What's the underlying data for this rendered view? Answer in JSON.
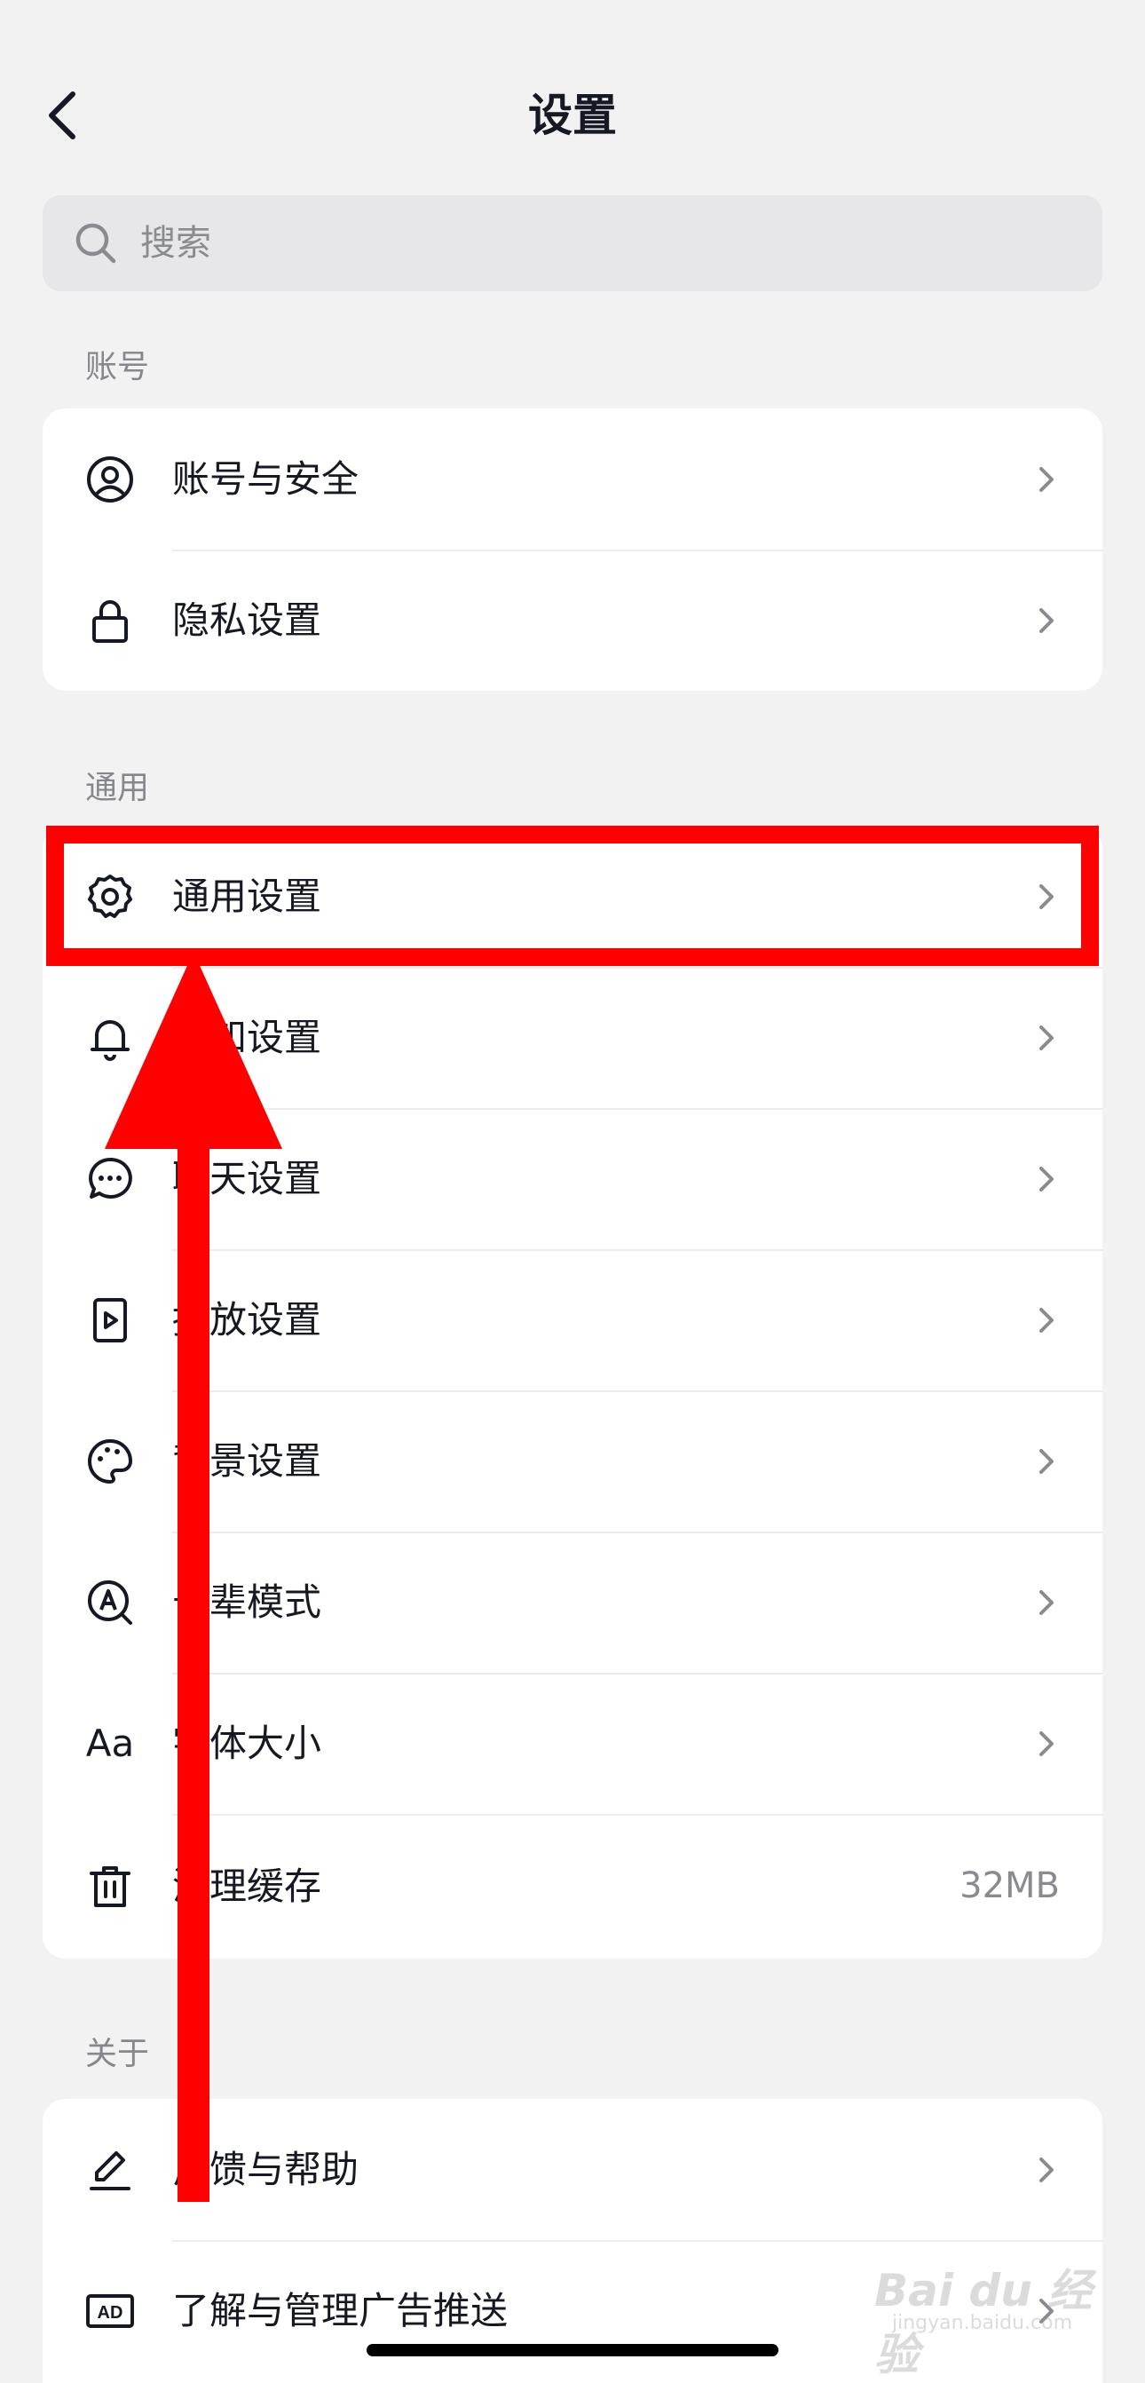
{
  "header": {
    "title": "设置"
  },
  "search": {
    "placeholder": "搜索"
  },
  "sections": {
    "account": {
      "title": "账号",
      "items": [
        {
          "label": "账号与安全",
          "icon": "user-circle-icon"
        },
        {
          "label": "隐私设置",
          "icon": "lock-icon"
        }
      ]
    },
    "general": {
      "title": "通用",
      "items": [
        {
          "label": "通用设置",
          "icon": "gear-icon"
        },
        {
          "label": "通知设置",
          "icon": "bell-icon"
        },
        {
          "label": "聊天设置",
          "icon": "chat-bubble-icon"
        },
        {
          "label": "播放设置",
          "icon": "play-file-icon"
        },
        {
          "label": "背景设置",
          "icon": "palette-icon"
        },
        {
          "label": "长辈模式",
          "icon": "elder-mode-icon"
        },
        {
          "label": "字体大小",
          "icon": "font-size-icon",
          "icon_text": "Aa"
        },
        {
          "label": "清理缓存",
          "icon": "trash-icon",
          "value": "32MB"
        }
      ]
    },
    "about": {
      "title": "关于",
      "items": [
        {
          "label": "反馈与帮助",
          "icon": "pencil-icon"
        },
        {
          "label": "了解与管理广告推送",
          "icon": "ad-icon",
          "icon_text": "AD"
        }
      ]
    }
  },
  "annotation": {
    "highlight_color": "#ff0000",
    "arrow_color": "#ff0000"
  },
  "watermark": {
    "text": "Bai du 经验",
    "sub": "jingyan.baidu.com"
  }
}
